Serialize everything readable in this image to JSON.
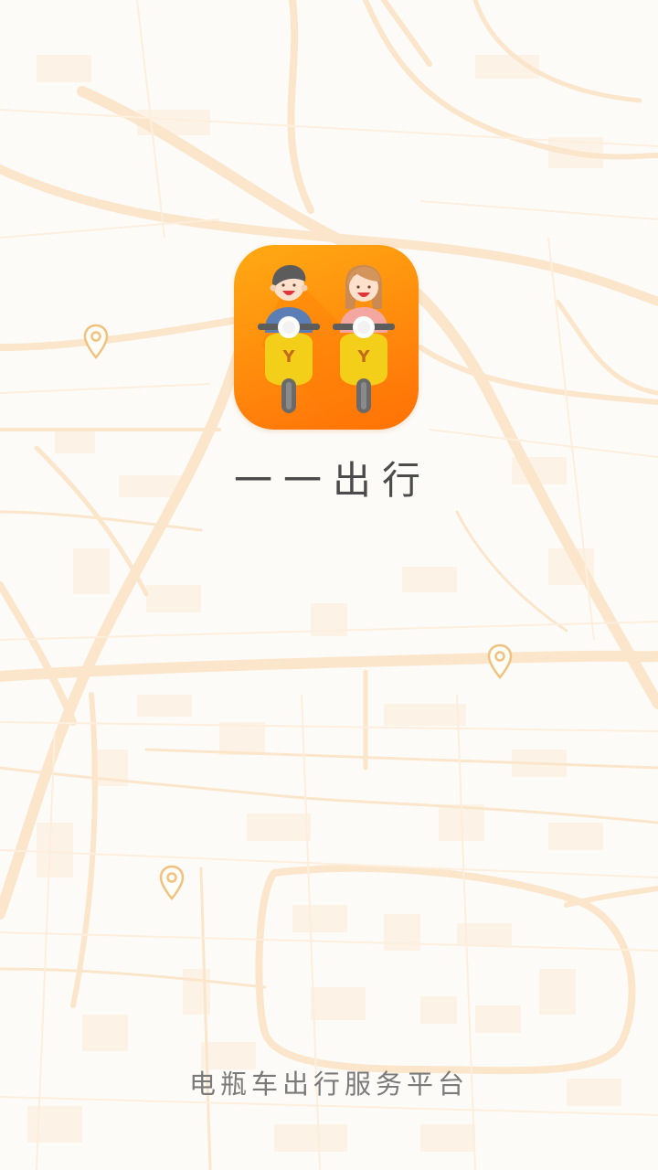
{
  "splash": {
    "app_name": "一一出行",
    "tagline": "电瓶车出行服务平台",
    "logo_text": "Y"
  },
  "colors": {
    "background": "#fdfbf8",
    "map_roads": "#fbe6cc",
    "pin": "#f3c98a",
    "icon_gradient_top": "#ffaa13",
    "icon_gradient_bottom": "#ff6f07",
    "scooter": "#f6d21a"
  },
  "icons": [
    "map-pin-icon",
    "map-pin-icon",
    "map-pin-icon",
    "app-logo-icon"
  ]
}
